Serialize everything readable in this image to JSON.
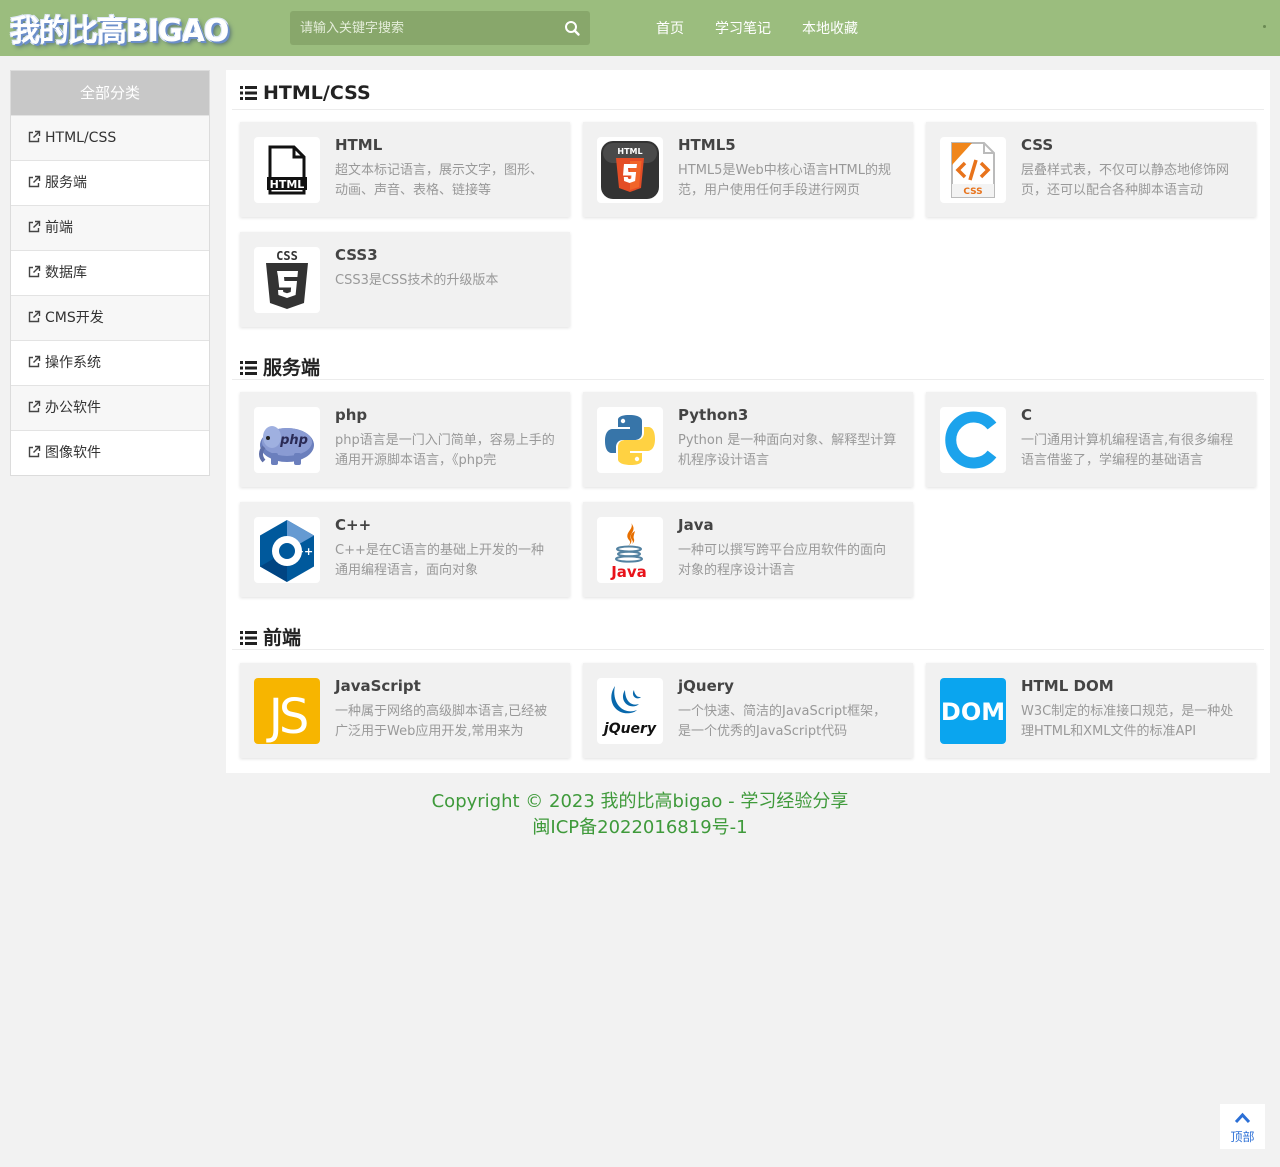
{
  "header": {
    "logo": "我的比高BIGAO",
    "search_placeholder": "请输入关键字搜索",
    "nav": [
      "首页",
      "学习笔记",
      "本地收藏"
    ]
  },
  "sidebar": {
    "title": "全部分类",
    "items": [
      "HTML/CSS",
      "服务端",
      "前端",
      "数据库",
      "CMS开发",
      "操作系统",
      "办公软件",
      "图像软件"
    ]
  },
  "sections": [
    {
      "title": "HTML/CSS",
      "cards": [
        {
          "title": "HTML",
          "desc": "超文本标记语言，展示文字，图形、动画、声音、表格、链接等",
          "icon": "html-file-icon"
        },
        {
          "title": "HTML5",
          "desc": "HTML5是Web中核心语言HTML的规范，用户使用任何手段进行网页",
          "icon": "html5-icon"
        },
        {
          "title": "CSS",
          "desc": "层叠样式表，不仅可以静态地修饰网页，还可以配合各种脚本语言动",
          "icon": "css-icon"
        },
        {
          "title": "CSS3",
          "desc": "CSS3是CSS技术的升级版本",
          "icon": "css3-icon"
        }
      ]
    },
    {
      "title": "服务端",
      "cards": [
        {
          "title": "php",
          "desc": "php语言是一门入门简单，容易上手的通用开源脚本语言，《php完",
          "icon": "php-elephant-icon"
        },
        {
          "title": "Python3",
          "desc": "Python 是一种面向对象、解释型计算机程序设计语言",
          "icon": "python-icon"
        },
        {
          "title": "C",
          "desc": "一门通用计算机编程语言,有很多编程语言借鉴了，学编程的基础语言",
          "icon": "c-language-icon"
        },
        {
          "title": "C++",
          "desc": "C++是在C语言的基础上开发的一种通用编程语言，面向对象",
          "icon": "cplusplus-icon"
        },
        {
          "title": "Java",
          "desc": "一种可以撰写跨平台应用软件的面向对象的程序设计语言",
          "icon": "java-icon"
        }
      ]
    },
    {
      "title": "前端",
      "cards": [
        {
          "title": "JavaScript",
          "desc": "一种属于网络的高级脚本语言,已经被广泛用于Web应用开发,常用来为",
          "icon": "javascript-icon"
        },
        {
          "title": "jQuery",
          "desc": "一个快速、简洁的JavaScript框架，是一个优秀的JavaScript代码",
          "icon": "jquery-icon"
        },
        {
          "title": "HTML DOM",
          "desc": "W3C制定的标准接口规范，是一种处理HTML和XML文件的标准API",
          "icon": "dom-icon"
        }
      ]
    }
  ],
  "icon_text": {
    "html_file": "</>",
    "html_file_label": "HTML",
    "html5_label": "HTML",
    "css_file_label": "CSS",
    "css3_label": "CSS",
    "java_label": "Java",
    "jquery_label": "jQuery",
    "js_label": "JS",
    "dom_label": "DOM"
  },
  "footer": {
    "copyright": "Copyright © 2023 我的比高bigao - 学习经验分享",
    "icp": "闽ICP备2022016819号-1"
  },
  "back_to_top": "顶部",
  "colors": {
    "header_bg": "#9bbd7e",
    "footer_text": "#3f9a3b",
    "top_link": "#2b6fd6"
  }
}
